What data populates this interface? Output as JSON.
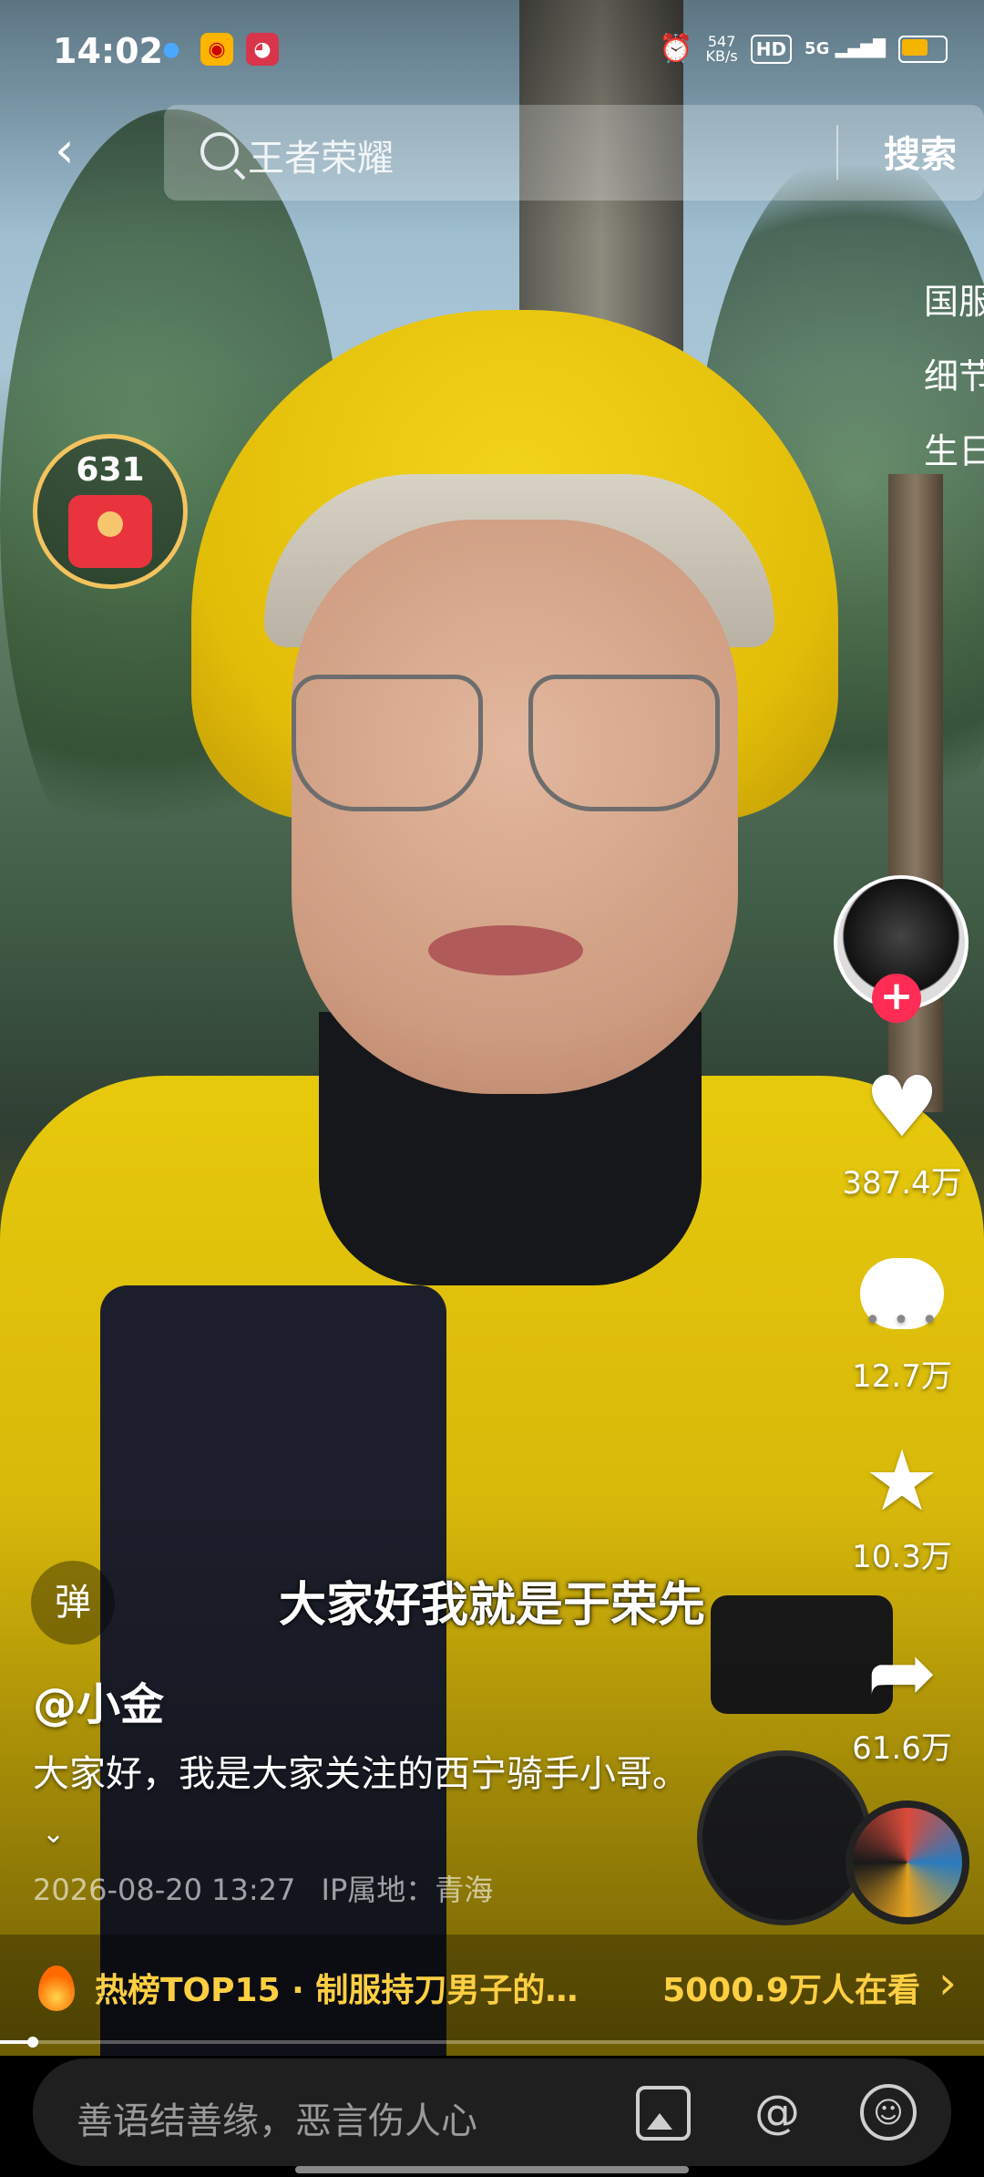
{
  "status_bar": {
    "time": "14:02",
    "net_speed_value": "547",
    "net_speed_unit": "KB/s",
    "hd": "HD",
    "signal": "5G",
    "battery_level": 0.6,
    "battery_color": "#f5b400"
  },
  "search": {
    "query": "王者荣耀",
    "button": "搜索"
  },
  "side_text": [
    "国服",
    "细节",
    "生日"
  ],
  "red_packet": {
    "count": "631"
  },
  "actions": {
    "likes": "387.4万",
    "comments": "12.7万",
    "favorites": "10.3万",
    "shares": "61.6万"
  },
  "danmu_label": "弹",
  "subtitle": "大家好我就是于荣先",
  "author": "@小金",
  "description": "大家好，我是大家关注的西宁骑手小哥。",
  "description_more": "⌄",
  "meta": {
    "date": "2026-08-20 13:27",
    "ip_location": "IP属地：青海"
  },
  "hot": {
    "title": "热榜TOP15 · 制服持刀男子的…",
    "viewers": "5000.9万人在看"
  },
  "playback_progress": 0.03,
  "comment_bar": {
    "placeholder": "善语结善缘，恶言伤人心"
  },
  "icons": {
    "back": "chevron-left-icon",
    "search": "search-icon",
    "like": "heart-icon",
    "comment": "comment-bubble-icon",
    "favorite": "star-icon",
    "share": "share-arrow-icon",
    "image": "image-icon",
    "mention": "at-icon",
    "emoji": "emoji-icon"
  },
  "colors": {
    "follow_button": "#fe2c55",
    "hot_text": "#ffcf42"
  }
}
